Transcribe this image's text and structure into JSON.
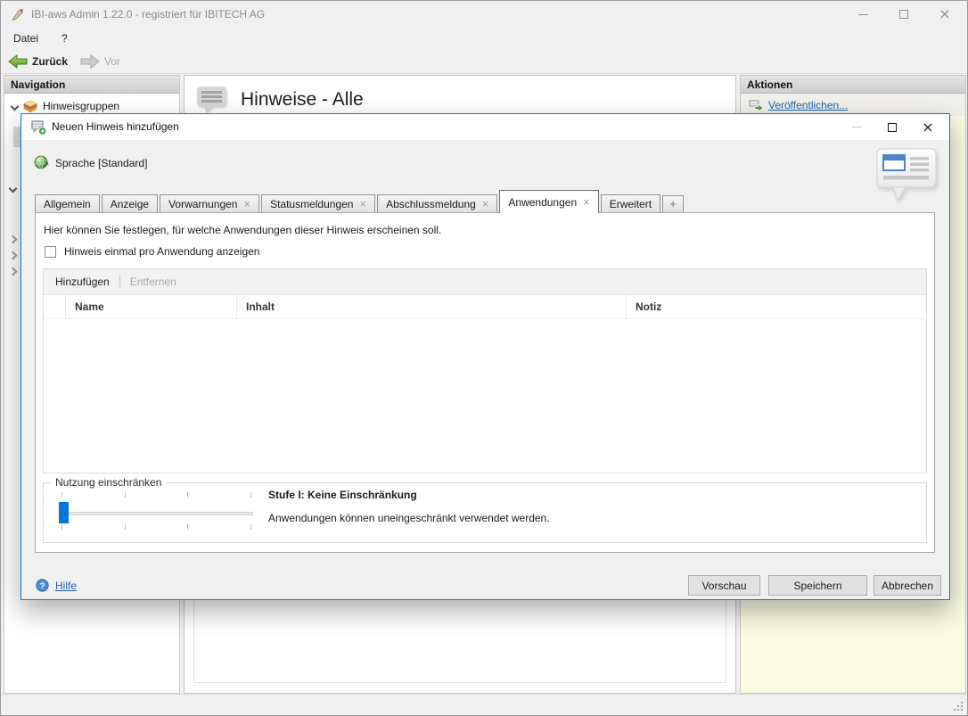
{
  "colors": {
    "accent": "#0078d7",
    "dialogBorder": "#0079d8",
    "link": "#1a66b3",
    "panelYellow": "#fbfbe2",
    "green": "#3ba336"
  },
  "window": {
    "title": "IBI-aws Admin 1.22.0 - registriert für IBITECH AG",
    "menu": {
      "file": "Datei",
      "help": "?"
    },
    "toolbar": {
      "back": "Zurück",
      "forward": "Vor"
    },
    "nav": {
      "header": "Navigation",
      "root_item": "Hinweisgruppen"
    },
    "main": {
      "title": "Hinweise - Alle"
    },
    "actions": {
      "header": "Aktionen",
      "publish_link": "Veröffentlichen..."
    }
  },
  "dialog": {
    "title": "Neuen Hinweis hinzufügen",
    "language_label": "Sprache [Standard]",
    "tabs": [
      {
        "label": "Allgemein",
        "closable": false,
        "active": false
      },
      {
        "label": "Anzeige",
        "closable": false,
        "active": false
      },
      {
        "label": "Vorwarnungen",
        "closable": true,
        "active": false
      },
      {
        "label": "Statusmeldungen",
        "closable": true,
        "active": false
      },
      {
        "label": "Abschlussmeldung",
        "closable": true,
        "active": false
      },
      {
        "label": "Anwendungen",
        "closable": true,
        "active": true
      },
      {
        "label": "Erweitert",
        "closable": false,
        "active": false
      }
    ],
    "tab_add_label": "+",
    "page": {
      "instruction": "Hier können Sie festlegen, für welche Anwendungen dieser Hinweis erscheinen soll.",
      "checkbox_label": "Hinweis einmal pro Anwendung anzeigen",
      "checkbox_checked": false,
      "list_toolbar": {
        "add": "Hinzufügen",
        "remove": "Entfernen"
      },
      "table": {
        "columns": [
          "Name",
          "Inhalt",
          "Notiz"
        ],
        "rows": []
      },
      "restriction": {
        "legend": "Nutzung einschränken",
        "level_title": "Stufe I: Keine Einschränkung",
        "level_description": "Anwendungen können uneingeschränkt verwendet werden.",
        "slider_level": 1,
        "slider_levels": 4
      }
    },
    "footer": {
      "help": "Hilfe",
      "preview": "Vorschau",
      "save": "Speichern",
      "cancel": "Abbrechen"
    }
  }
}
